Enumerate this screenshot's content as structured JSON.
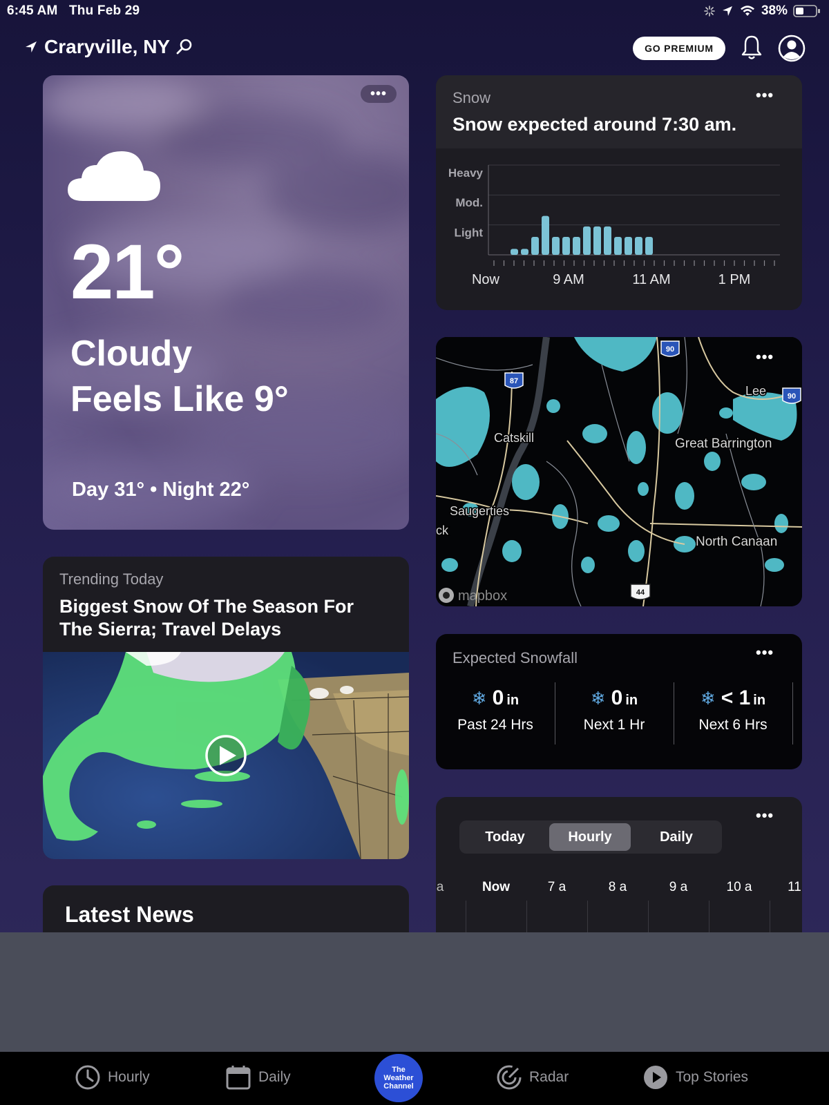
{
  "status_bar": {
    "time": "6:45 AM",
    "date": "Thu Feb 29",
    "battery": "38%"
  },
  "header": {
    "location": "Craryville, NY",
    "premium_label": "GO PREMIUM"
  },
  "current": {
    "temp": "21°",
    "condition": "Cloudy",
    "feels_like": "Feels Like 9°",
    "day_night": "Day 31° • Night 22°",
    "icon": "cloud-icon"
  },
  "snow_card": {
    "label": "Snow",
    "title": "Snow expected around 7:30 am."
  },
  "chart_data": {
    "type": "bar",
    "levels": [
      "Heavy",
      "Mod.",
      "Light"
    ],
    "x_ticks": [
      "Now",
      "9 AM",
      "11 AM",
      "1 PM"
    ],
    "intensity": [
      0.2,
      0.2,
      0.6,
      1.3,
      0.6,
      0.6,
      0.6,
      0.95,
      0.95,
      0.95,
      0.6,
      0.6,
      0.6,
      0.6
    ],
    "ylim": [
      0,
      3
    ],
    "color": "#7cc3d6"
  },
  "map": {
    "labels": [
      "Catskill",
      "Great Barrington",
      "Saugerties",
      "North Canaan",
      "Lee",
      "ck"
    ],
    "shields": [
      "87",
      "90",
      "90",
      "44"
    ],
    "attribution": "mapbox"
  },
  "trending": {
    "label": "Trending Today",
    "title": "Biggest Snow Of The Season For The Sierra; Travel Delays"
  },
  "latest_news": {
    "title": "Latest News"
  },
  "snowfall": {
    "label": "Expected Snowfall",
    "items": [
      {
        "value": "0",
        "unit": "in",
        "caption": "Past 24 Hrs"
      },
      {
        "value": "0",
        "unit": "in",
        "caption": "Next 1 Hr"
      },
      {
        "value": "< 1",
        "unit": "in",
        "caption": "Next 6 Hrs"
      }
    ]
  },
  "forecast": {
    "tabs": [
      "Today",
      "Hourly",
      "Daily"
    ],
    "active_tab": "Hourly",
    "hours": [
      "a",
      "Now",
      "7 a",
      "8 a",
      "9 a",
      "10 a",
      "11"
    ]
  },
  "tab_bar": {
    "items": [
      "Hourly",
      "Daily",
      "Radar",
      "Top Stories"
    ],
    "logo": [
      "The",
      "Weather",
      "Channel"
    ]
  }
}
